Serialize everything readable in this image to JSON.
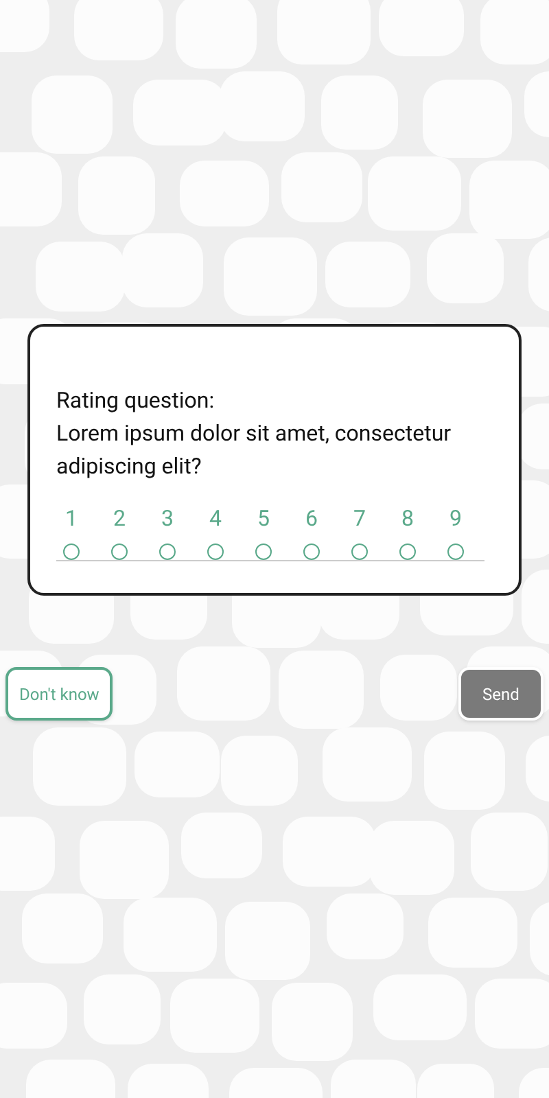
{
  "question": {
    "label": "Rating question:",
    "text": "Lorem ipsum dolor sit amet, consectetur adipiscing elit?"
  },
  "options": [
    {
      "label": "1",
      "selected": false
    },
    {
      "label": "2",
      "selected": false
    },
    {
      "label": "3",
      "selected": false
    },
    {
      "label": "4",
      "selected": false
    },
    {
      "label": "5",
      "selected": false
    },
    {
      "label": "6",
      "selected": false
    },
    {
      "label": "7",
      "selected": false
    },
    {
      "label": "8",
      "selected": false
    },
    {
      "label": "9",
      "selected": false
    }
  ],
  "dont_know": {
    "label": "Don't know",
    "selected": false
  },
  "send": {
    "label": "Send",
    "disabled": true
  }
}
